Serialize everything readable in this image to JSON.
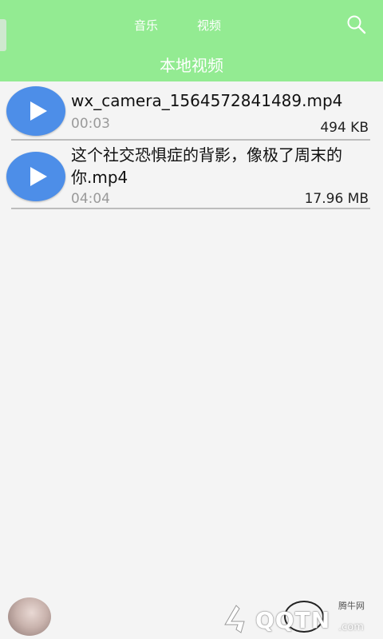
{
  "header": {
    "tabs": [
      {
        "label": "音乐"
      },
      {
        "label": "视频"
      }
    ],
    "title": "本地视频",
    "search_icon": "search-icon",
    "background": "#93eb92"
  },
  "videos": [
    {
      "name": "wx_camera_1564572841489.mp4",
      "duration": "00:03",
      "size": "494 KB"
    },
    {
      "name": "这个社交恐惧症的背影，像极了周末的你.mp4",
      "duration": "04:04",
      "size": "17.96 MB"
    }
  ],
  "accent": "#4d8ee8",
  "watermark": {
    "brand": "QQTN",
    "suffix": ".com",
    "label": "腾牛网"
  }
}
